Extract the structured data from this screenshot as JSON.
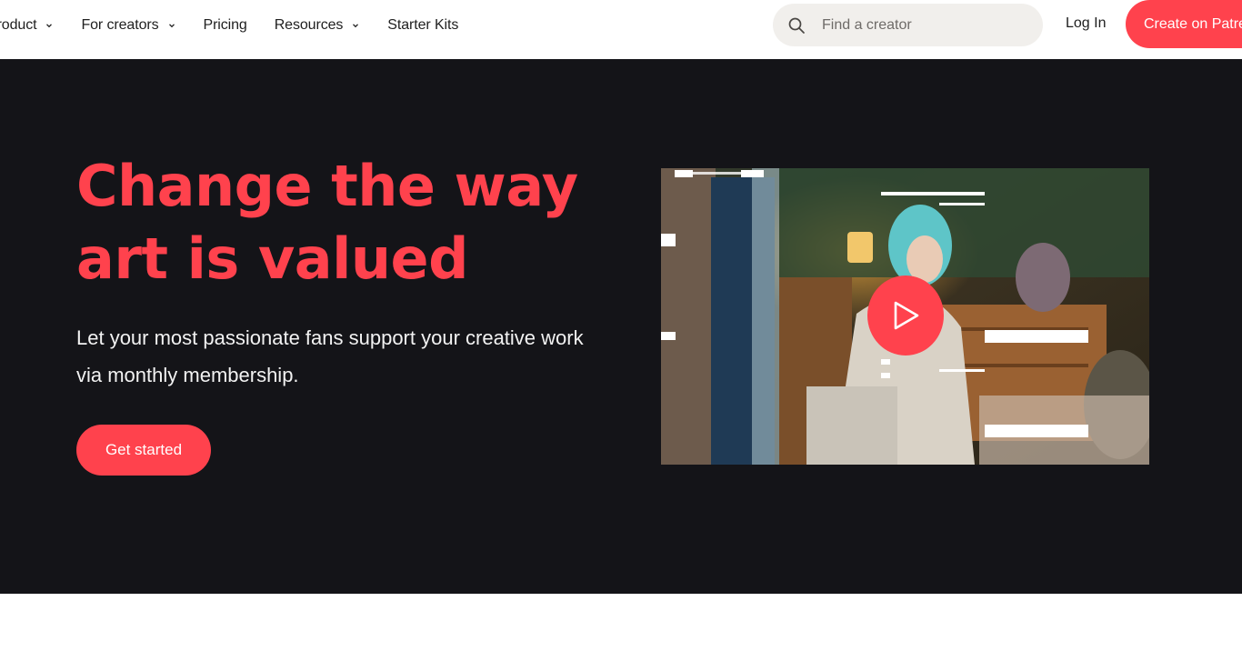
{
  "nav": {
    "items": [
      {
        "label": "Product",
        "has_dropdown": true
      },
      {
        "label": "For creators",
        "has_dropdown": true
      },
      {
        "label": "Pricing",
        "has_dropdown": false
      },
      {
        "label": "Resources",
        "has_dropdown": true
      },
      {
        "label": "Starter Kits",
        "has_dropdown": false
      }
    ],
    "search": {
      "placeholder": "Find a creator",
      "icon": "search-icon"
    },
    "login_label": "Log In",
    "create_label": "Create on Patreon"
  },
  "hero": {
    "headline": "Change the way art is valued",
    "subtext": "Let your most passionate fans support your creative work via monthly membership.",
    "cta_label": "Get started",
    "video": {
      "play_icon": "play-icon"
    }
  },
  "colors": {
    "accent": "#ff424d",
    "hero_bg": "#141418",
    "search_bg": "#f1efec"
  }
}
